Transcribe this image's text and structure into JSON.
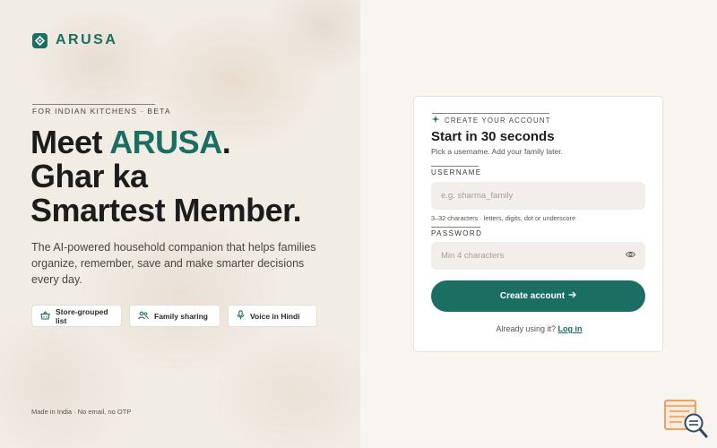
{
  "brand": {
    "name": "ARUSA",
    "accent_color": "#1a6e62"
  },
  "hero": {
    "kicker": "FOR INDIAN KITCHENS · BETA",
    "headline_line1_prefix": "Meet ",
    "headline_line1_accent": "ARUSA",
    "headline_line1_suffix": ".",
    "headline_line2": "Ghar ka",
    "headline_line3": "Smartest Member.",
    "description": "The AI-powered household companion that helps families organize, remember, save and make smarter decisions every day.",
    "features": [
      {
        "label": "Store-grouped list",
        "icon": "basket-icon"
      },
      {
        "label": "Family sharing",
        "icon": "people-icon"
      },
      {
        "label": "Voice in Hindi",
        "icon": "microphone-icon"
      }
    ],
    "footnote": "Made in India · No email, no OTP"
  },
  "signup": {
    "kicker": "CREATE YOUR ACCOUNT",
    "title": "Start in 30 seconds",
    "subtitle": "Pick a username. Add your family later.",
    "username": {
      "label": "USERNAME",
      "placeholder": "e.g. sharma_family",
      "value": "",
      "hint": "3–32 characters · letters, digits, dot or underscore"
    },
    "password": {
      "label": "PASSWORD",
      "placeholder": "Min 4 characters",
      "value": ""
    },
    "submit_label": "Create account",
    "already_text": "Already using it?",
    "login_link": "Log in"
  },
  "help_widget": {
    "icon": "help-search-icon"
  }
}
